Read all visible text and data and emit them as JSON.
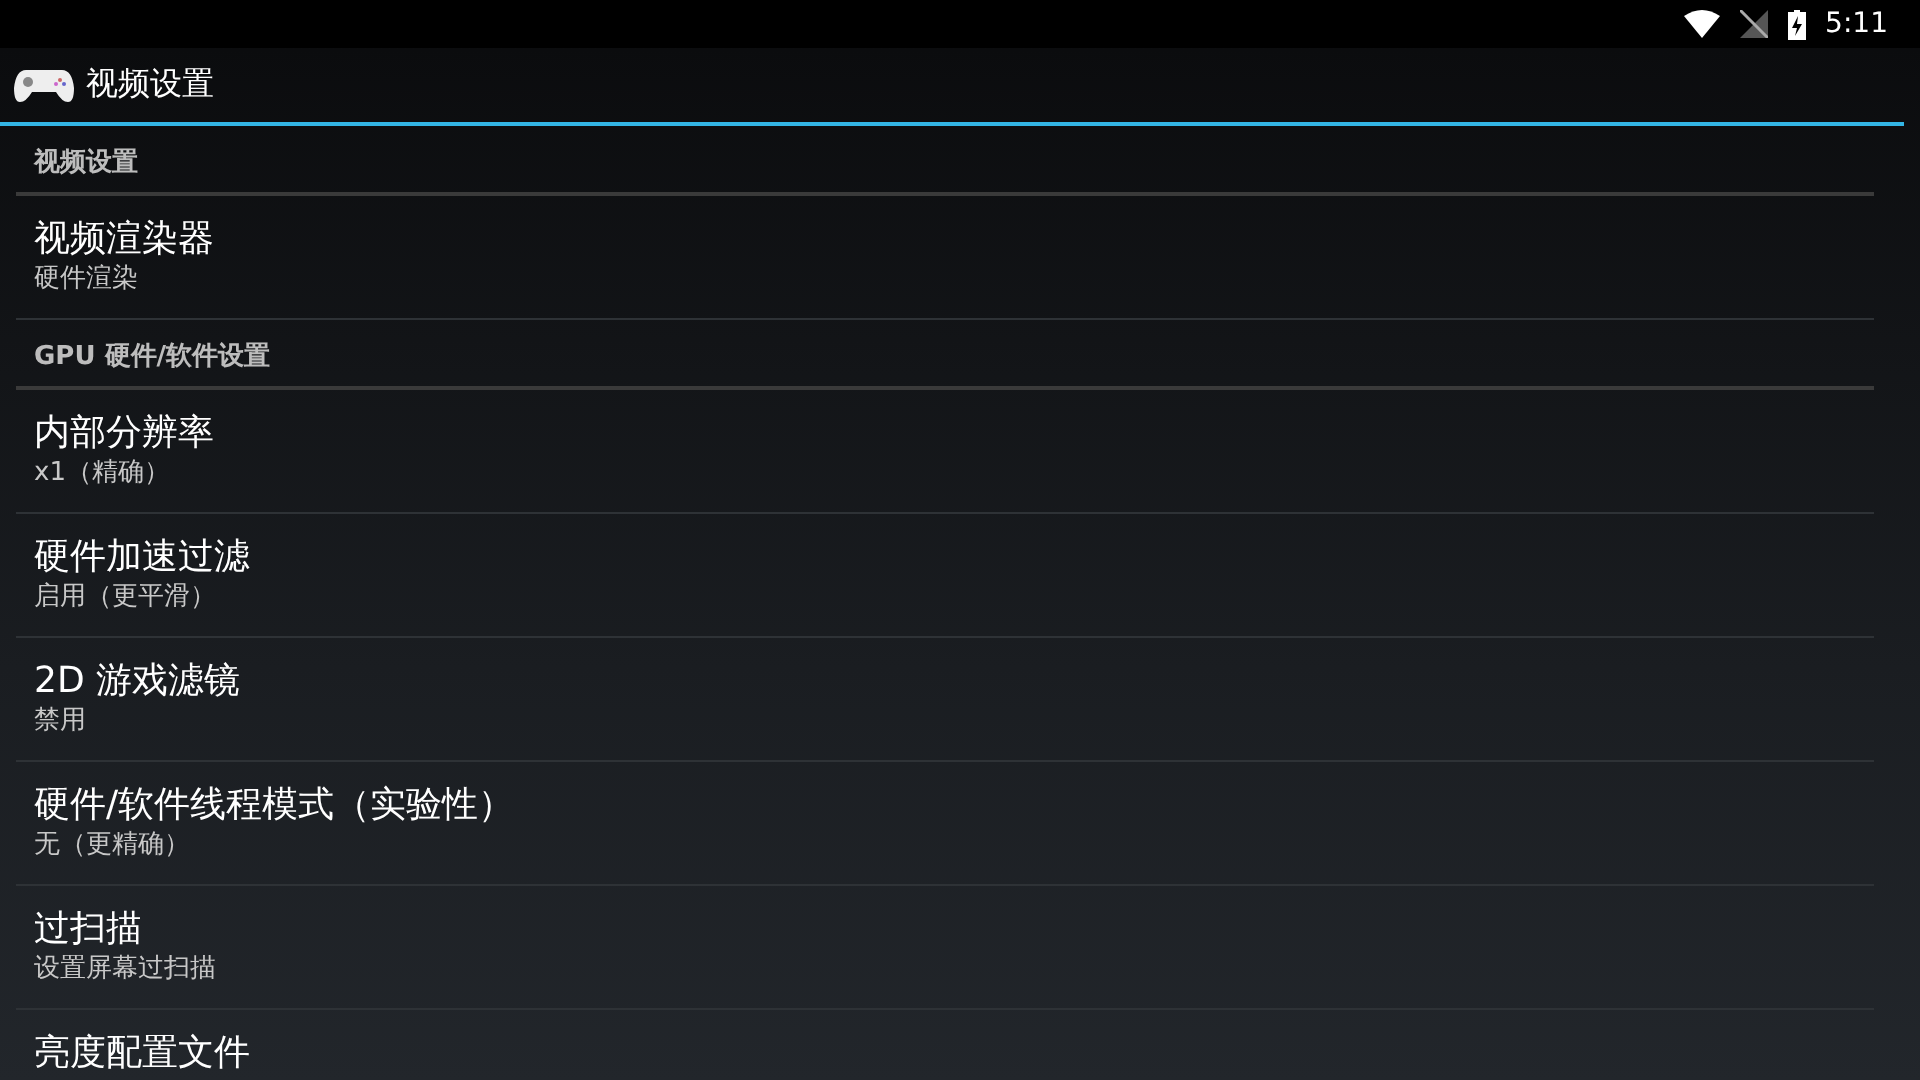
{
  "status_bar": {
    "time": "5:11"
  },
  "action_bar": {
    "title": "视频设置"
  },
  "sections": [
    {
      "header": "视频设置",
      "items": [
        {
          "title": "视频渲染器",
          "summary": "硬件渲染"
        }
      ]
    },
    {
      "header": "GPU 硬件/软件设置",
      "items": [
        {
          "title": "内部分辨率",
          "summary": "x1（精确）"
        },
        {
          "title": "硬件加速过滤",
          "summary": "启用（更平滑）"
        },
        {
          "title": "2D 游戏滤镜",
          "summary": "禁用"
        },
        {
          "title": "硬件/软件线程模式（实验性）",
          "summary": "无（更精确）"
        },
        {
          "title": "过扫描",
          "summary": "设置屏幕过扫描"
        },
        {
          "title": "亮度配置文件"
        }
      ]
    }
  ]
}
